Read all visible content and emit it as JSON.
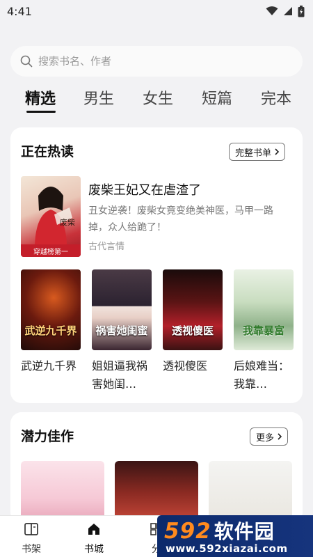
{
  "status_bar": {
    "time": "4:41"
  },
  "search": {
    "placeholder": "搜索书名、作者"
  },
  "tabs": [
    {
      "label": "精选",
      "active": true
    },
    {
      "label": "男生",
      "active": false
    },
    {
      "label": "女生",
      "active": false
    },
    {
      "label": "短篇",
      "active": false
    },
    {
      "label": "完本",
      "active": false
    }
  ],
  "hot_section": {
    "title": "正在热读",
    "more_label": "完整书单",
    "featured": {
      "title": "废柴王妃又在虐渣了",
      "description": "丑女逆袭！废柴女竟变绝美神医，马甲一路掉，众人给跪了！",
      "category": "古代言情",
      "badge": "穿越榜第一",
      "cover_icon": "book-cover-illustration"
    },
    "books": [
      {
        "title": "武逆九千界",
        "cover_text": "武逆九千界",
        "cover_color": "#2a0f0c"
      },
      {
        "title": "姐姐逼我祸害她闺…",
        "cover_text": "祸害她闺蜜",
        "cover_color": "#2b2230"
      },
      {
        "title": "透视傻医",
        "cover_text": "透视傻医",
        "cover_color": "#3a1212"
      },
      {
        "title": "后娘难当：我靠…",
        "cover_text": "我靠暴富",
        "cover_color": "#d9e8d2"
      }
    ]
  },
  "potential_section": {
    "title": "潜力佳作",
    "more_label": "更多"
  },
  "bottom_nav": [
    {
      "label": "书架",
      "icon": "bookshelf-icon",
      "active": false
    },
    {
      "label": "书城",
      "icon": "home-icon",
      "active": true
    },
    {
      "label": "分",
      "icon": "category-icon",
      "active": false
    }
  ],
  "watermark": {
    "logo_number": "592",
    "logo_text": "软件园",
    "url": "www.592xiazai.com"
  },
  "colors": {
    "accent": "#111111",
    "card_bg": "#ffffff",
    "page_bg": "#f2f2f4",
    "badge_red": "#c41e2a"
  }
}
